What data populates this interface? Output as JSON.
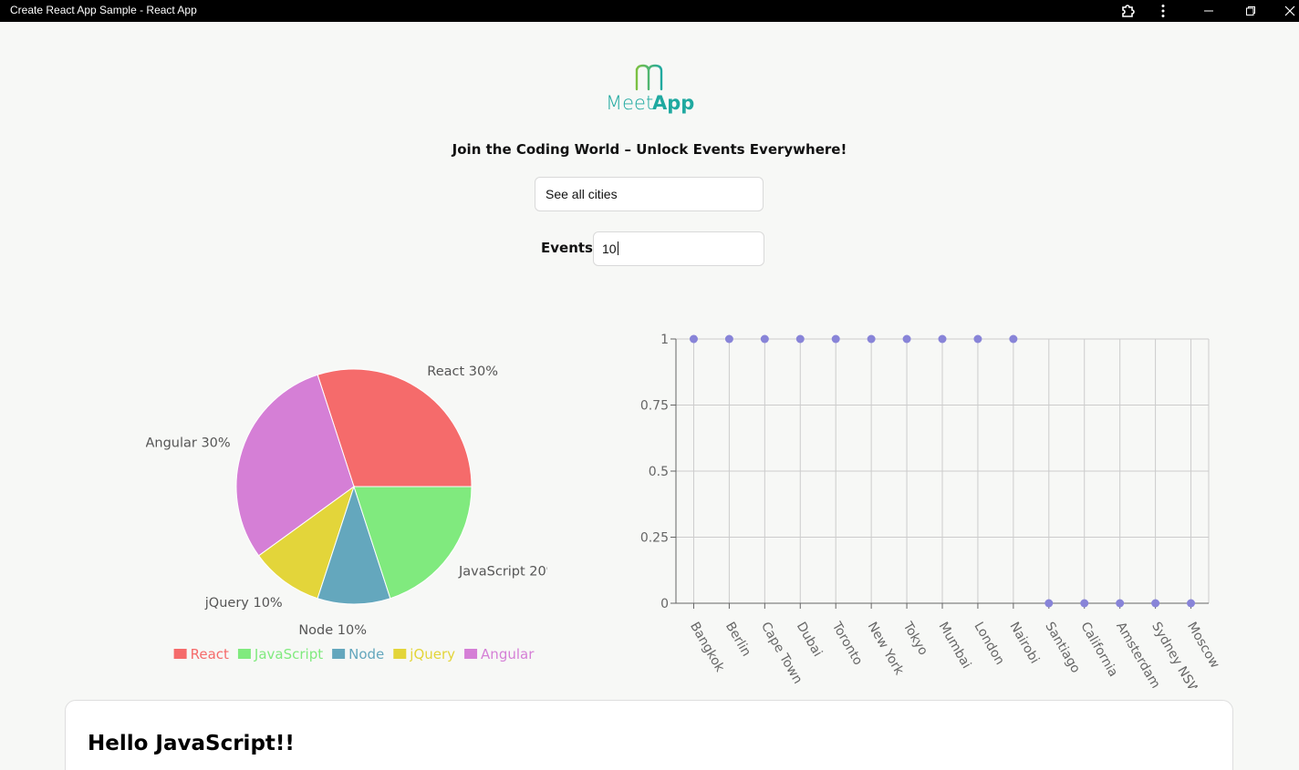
{
  "window": {
    "title": "Create React App Sample - React App"
  },
  "logo": {
    "text_meet": "Meet",
    "text_app": "App",
    "color_teal": "#1fa9a0",
    "color_green": "#7cc142"
  },
  "headline": "Join the Coding World – Unlock Events Everywhere!",
  "city_search": {
    "value": "See all cities"
  },
  "events": {
    "label": "Events",
    "value": "10"
  },
  "chart_data": [
    {
      "type": "pie",
      "slices": [
        {
          "label": "React",
          "value": 30,
          "color": "#f56b6b"
        },
        {
          "label": "Angular",
          "value": 30,
          "color": "#d57fd6"
        },
        {
          "label": "jQuery",
          "value": 10,
          "color": "#e3d53a"
        },
        {
          "label": "Node",
          "value": 10,
          "color": "#64a7bd"
        },
        {
          "label": "JavaScript",
          "value": 20,
          "color": "#80ea7e"
        }
      ],
      "legend": [
        "React",
        "JavaScript",
        "Node",
        "jQuery",
        "Angular"
      ],
      "legend_placement": "bottom"
    },
    {
      "type": "scatter",
      "categories": [
        "Bangkok",
        "Berlin",
        "Cape Town",
        "Dubai",
        "Toronto",
        "New York",
        "Tokyo",
        "Mumbai",
        "London",
        "Nairobi",
        "Santiago",
        "California",
        "Amsterdam",
        "Sydney NSW",
        "Moscow"
      ],
      "values": [
        1,
        1,
        1,
        1,
        1,
        1,
        1,
        1,
        1,
        1,
        0,
        0,
        0,
        0,
        0
      ],
      "yticks": [
        "0",
        "0.25",
        "0.5",
        "0.75",
        "1"
      ],
      "ylim": [
        0,
        1
      ],
      "grid": true,
      "point_color": "#8884d8"
    }
  ],
  "card": {
    "title": "Hello JavaScript!!"
  }
}
